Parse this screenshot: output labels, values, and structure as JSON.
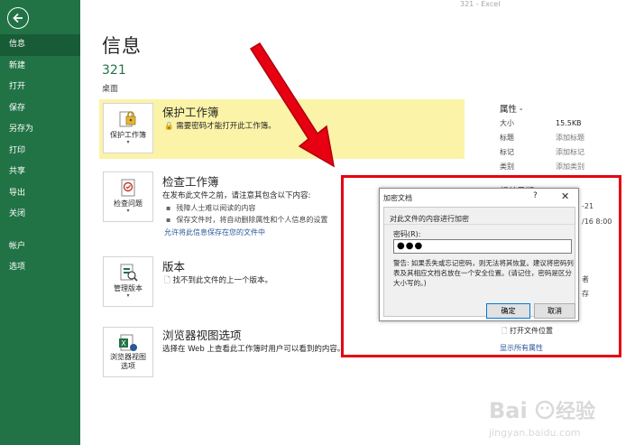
{
  "app_title": "321 - Excel",
  "sidebar": {
    "items": [
      {
        "label": "信息",
        "active": true
      },
      {
        "label": "新建"
      },
      {
        "label": "打开"
      },
      {
        "label": "保存"
      },
      {
        "label": "另存为"
      },
      {
        "label": "打印"
      },
      {
        "label": "共享"
      },
      {
        "label": "导出"
      },
      {
        "label": "关闭"
      }
    ],
    "bottom_items": [
      {
        "label": "帐户"
      },
      {
        "label": "选项"
      }
    ]
  },
  "main": {
    "title": "信息",
    "file_name": "321",
    "file_location": "桌面",
    "protect": {
      "button_label": "保护工作簿",
      "title": "保护工作簿",
      "desc": "需要密码才能打开此工作簿。"
    },
    "inspect": {
      "button_label": "检查问题",
      "title": "检查工作簿",
      "desc": "在发布此文件之前，请注意其包含以下内容:",
      "bullets": [
        "残障人士难以阅读的内容",
        "保存文件时，将自动删除属性和个人信息的设置"
      ],
      "link": "允许将此信息保存在您的文件中"
    },
    "versions": {
      "button_label": "管理版本",
      "title": "版本",
      "desc": "找不到此文件的上一个版本。"
    },
    "browser": {
      "button_label_1": "浏览器视图",
      "button_label_2": "选项",
      "title": "浏览器视图选项",
      "desc": "选择在 Web 上查看此工作簿时用户可以看到的内容。"
    }
  },
  "properties": {
    "title": "属性 -",
    "rows": [
      {
        "key": "大小",
        "value": "15.5KB"
      },
      {
        "key": "标题",
        "value": "添加标题"
      },
      {
        "key": "标记",
        "value": "添加标记"
      },
      {
        "key": "类别",
        "value": "添加类别"
      }
    ],
    "partial_heading": "相关日期",
    "partial_1": "-21",
    "partial_2": "/16 8:00",
    "partial_3": "者",
    "partial_4": "存",
    "open_location": "打开文件位置",
    "show_all": "显示所有属性"
  },
  "dialog": {
    "title": "加密文档",
    "help": "?",
    "close": "✕",
    "heading": "对此文件的内容进行加密",
    "password_label": "密码(R):",
    "password_value": "●●●",
    "warning": "警告: 如果丢失或忘记密码，则无法将其恢复。建议将密码列表及其相应文档名放在一个安全位置。(请记住，密码是区分大小写的。)",
    "ok": "确定",
    "cancel": "取消"
  },
  "watermark": {
    "brand": "Baidu经验",
    "url": "jingyan.baidu.com"
  },
  "colors": {
    "sidebar": "#217346",
    "sidebar_active": "#185c37",
    "protect_bg": "#fbf3a7",
    "annotation_red": "#e60012",
    "link": "#2b579a"
  }
}
